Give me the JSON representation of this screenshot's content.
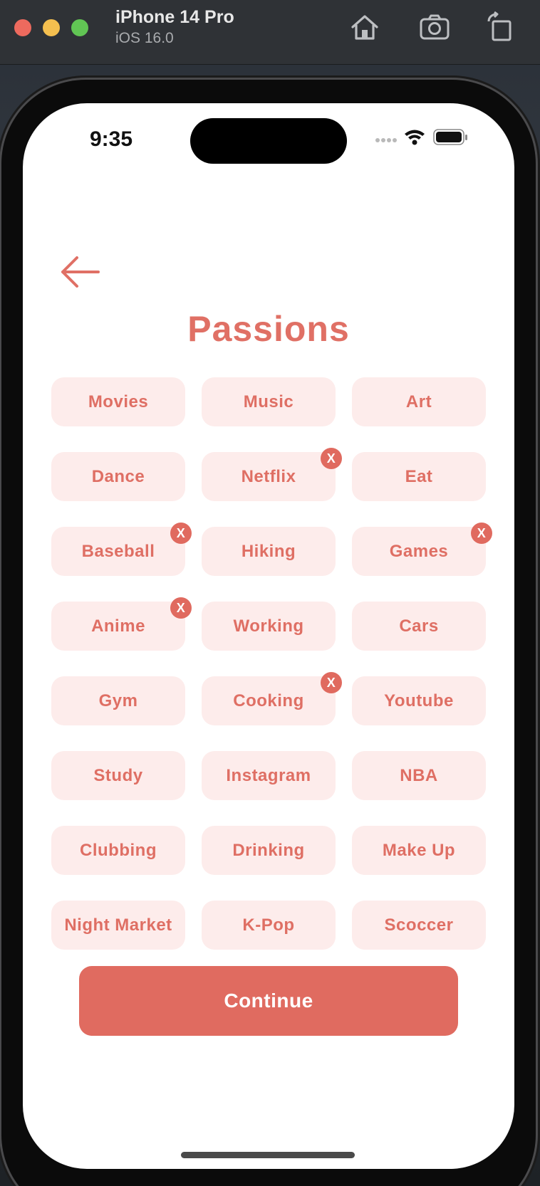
{
  "simulator": {
    "device_name": "iPhone 14 Pro",
    "os_version": "iOS 16.0",
    "home_icon": "home-icon",
    "screenshot_icon": "camera-icon",
    "rotate_icon": "rotate-icon"
  },
  "status_bar": {
    "time": "9:35",
    "icons": [
      "signal-dots-icon",
      "wifi-icon",
      "battery-icon"
    ]
  },
  "header": {
    "back_icon": "arrow-left-icon",
    "title": "Passions"
  },
  "passions": [
    {
      "label": "Movies",
      "selected": false
    },
    {
      "label": "Music",
      "selected": false
    },
    {
      "label": "Art",
      "selected": false
    },
    {
      "label": "Dance",
      "selected": false
    },
    {
      "label": "Netflix",
      "selected": true
    },
    {
      "label": "Eat",
      "selected": false
    },
    {
      "label": "Baseball",
      "selected": true
    },
    {
      "label": "Hiking",
      "selected": false
    },
    {
      "label": "Games",
      "selected": true
    },
    {
      "label": "Anime",
      "selected": true
    },
    {
      "label": "Working",
      "selected": false
    },
    {
      "label": "Cars",
      "selected": false
    },
    {
      "label": "Gym",
      "selected": false
    },
    {
      "label": "Cooking",
      "selected": true
    },
    {
      "label": "Youtube",
      "selected": false
    },
    {
      "label": "Study",
      "selected": false
    },
    {
      "label": "Instagram",
      "selected": false
    },
    {
      "label": "NBA",
      "selected": false
    },
    {
      "label": "Clubbing",
      "selected": false
    },
    {
      "label": "Drinking",
      "selected": false
    },
    {
      "label": "Make Up",
      "selected": false
    },
    {
      "label": "Night Market",
      "selected": false
    },
    {
      "label": "K-Pop",
      "selected": false
    },
    {
      "label": "Scoccer",
      "selected": false
    }
  ],
  "remove_badge_label": "X",
  "continue_label": "Continue",
  "colors": {
    "accent": "#e06b60",
    "chip_bg": "#fdeceb",
    "chip_text": "#df6f64"
  }
}
